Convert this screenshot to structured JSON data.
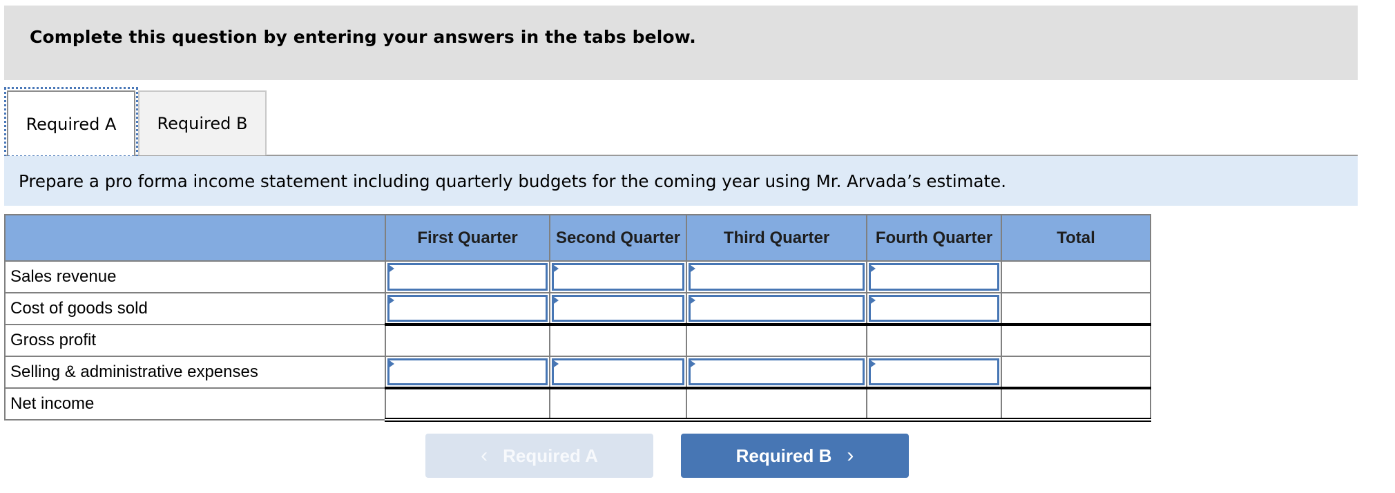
{
  "banner": {
    "text": "Complete this question by entering your answers in the tabs below."
  },
  "tabs": [
    {
      "label": "Required A",
      "active": true
    },
    {
      "label": "Required B",
      "active": false
    }
  ],
  "instructions": "Prepare a pro forma income statement including quarterly budgets for the coming year using Mr. Arvada’s estimate.",
  "table": {
    "headers": [
      "",
      "First Quarter",
      "Second Quarter",
      "Third Quarter",
      "Fourth Quarter",
      "Total"
    ],
    "rows": [
      {
        "label": "Sales revenue",
        "inputs": true,
        "values": [
          "",
          "",
          "",
          "",
          ""
        ]
      },
      {
        "label": "Cost of goods sold",
        "inputs": true,
        "values": [
          "",
          "",
          "",
          "",
          ""
        ]
      },
      {
        "label": "Gross profit",
        "inputs": false,
        "values": [
          "",
          "",
          "",
          "",
          ""
        ]
      },
      {
        "label": "Selling & administrative expenses",
        "inputs": true,
        "values": [
          "",
          "",
          "",
          "",
          ""
        ]
      },
      {
        "label": "Net income",
        "inputs": false,
        "values": [
          "",
          "",
          "",
          "",
          ""
        ]
      }
    ]
  },
  "nav": {
    "prev_label": "Required A",
    "prev_icon": "chevron-left-icon",
    "prev_enabled": false,
    "next_label": "Required B",
    "next_icon": "chevron-right-icon",
    "next_enabled": true
  },
  "colors": {
    "accent": "#4776b4",
    "header_bg": "#83abe0",
    "instruction_bg": "#deeaf7",
    "banner_bg": "#e0e0e0"
  }
}
